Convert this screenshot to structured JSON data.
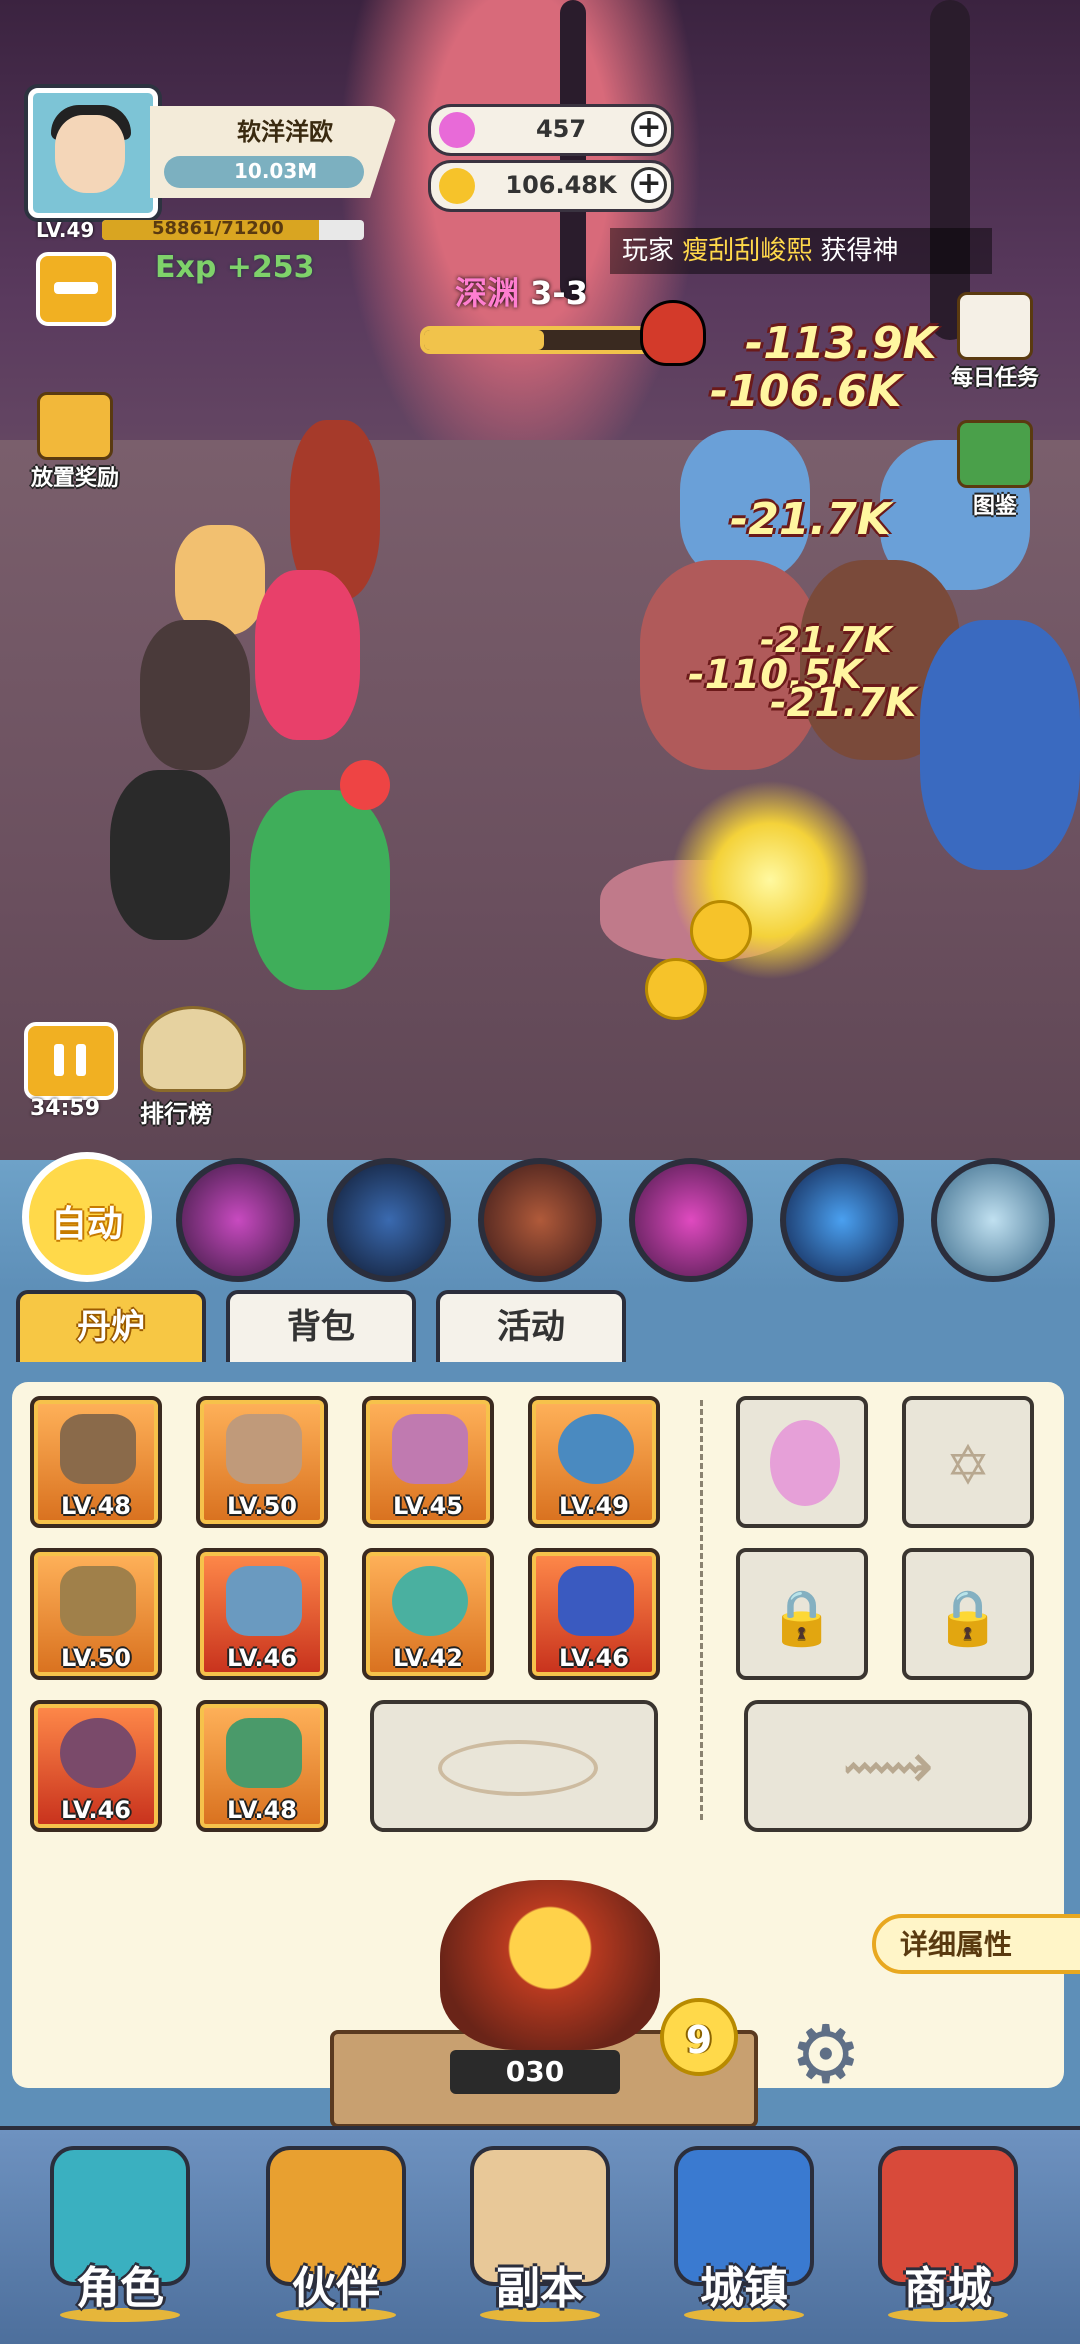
{
  "player": {
    "name": "软洋洋欧",
    "power": "10.03M",
    "level": "LV.49",
    "xp_text": "58861/71200",
    "xp_fraction": 0.827,
    "exp_gain": "Exp +253"
  },
  "currency": {
    "gems": "457",
    "gold": "106.48K"
  },
  "ticker": {
    "prefix": "玩家 ",
    "name": "瘦刮刮峻熙",
    "suffix": " 获得神"
  },
  "stage": {
    "name": "深渊",
    "number": "3-3",
    "progress_fraction": 0.48
  },
  "damage_numbers": [
    "-113.9K",
    "-106.6K",
    "-21.7K",
    "-21.7K",
    "-110.5K",
    "-21.7K"
  ],
  "side_menu": {
    "idle_reward": "放置奖励",
    "daily_task": "每日任务",
    "codex": "图鉴",
    "leaderboard": "排行榜"
  },
  "battle_timer": "34:59",
  "skills": {
    "auto_label": "自动"
  },
  "tabs": [
    {
      "label": "丹炉",
      "active": true
    },
    {
      "label": "背包",
      "active": false
    },
    {
      "label": "活动",
      "active": false
    }
  ],
  "equipment": [
    {
      "level": "LV.48",
      "icon": "spear-icon"
    },
    {
      "level": "LV.50",
      "icon": "helmet-icon"
    },
    {
      "level": "LV.45",
      "icon": "armor-icon"
    },
    {
      "level": "LV.49",
      "icon": "orb-icon"
    },
    {
      "level": "LV.50",
      "icon": "sword-icon"
    },
    {
      "level": "LV.46",
      "icon": "bagua-icon"
    },
    {
      "level": "LV.42",
      "icon": "ring-icon"
    },
    {
      "level": "LV.46",
      "icon": "amulet-icon"
    },
    {
      "level": "LV.46",
      "icon": "bracelet-icon"
    },
    {
      "level": "LV.48",
      "icon": "boots-icon"
    }
  ],
  "furnace": {
    "value": "030",
    "badge": "9",
    "detail_label": "详细属性"
  },
  "bottom_nav": [
    {
      "label": "角色"
    },
    {
      "label": "伙伴"
    },
    {
      "label": "副本"
    },
    {
      "label": "城镇"
    },
    {
      "label": "商城"
    }
  ],
  "colors": {
    "accent_gold": "#f7c744",
    "panel_blue": "#5e8fb8",
    "panel_cream": "#fbf6e0"
  }
}
